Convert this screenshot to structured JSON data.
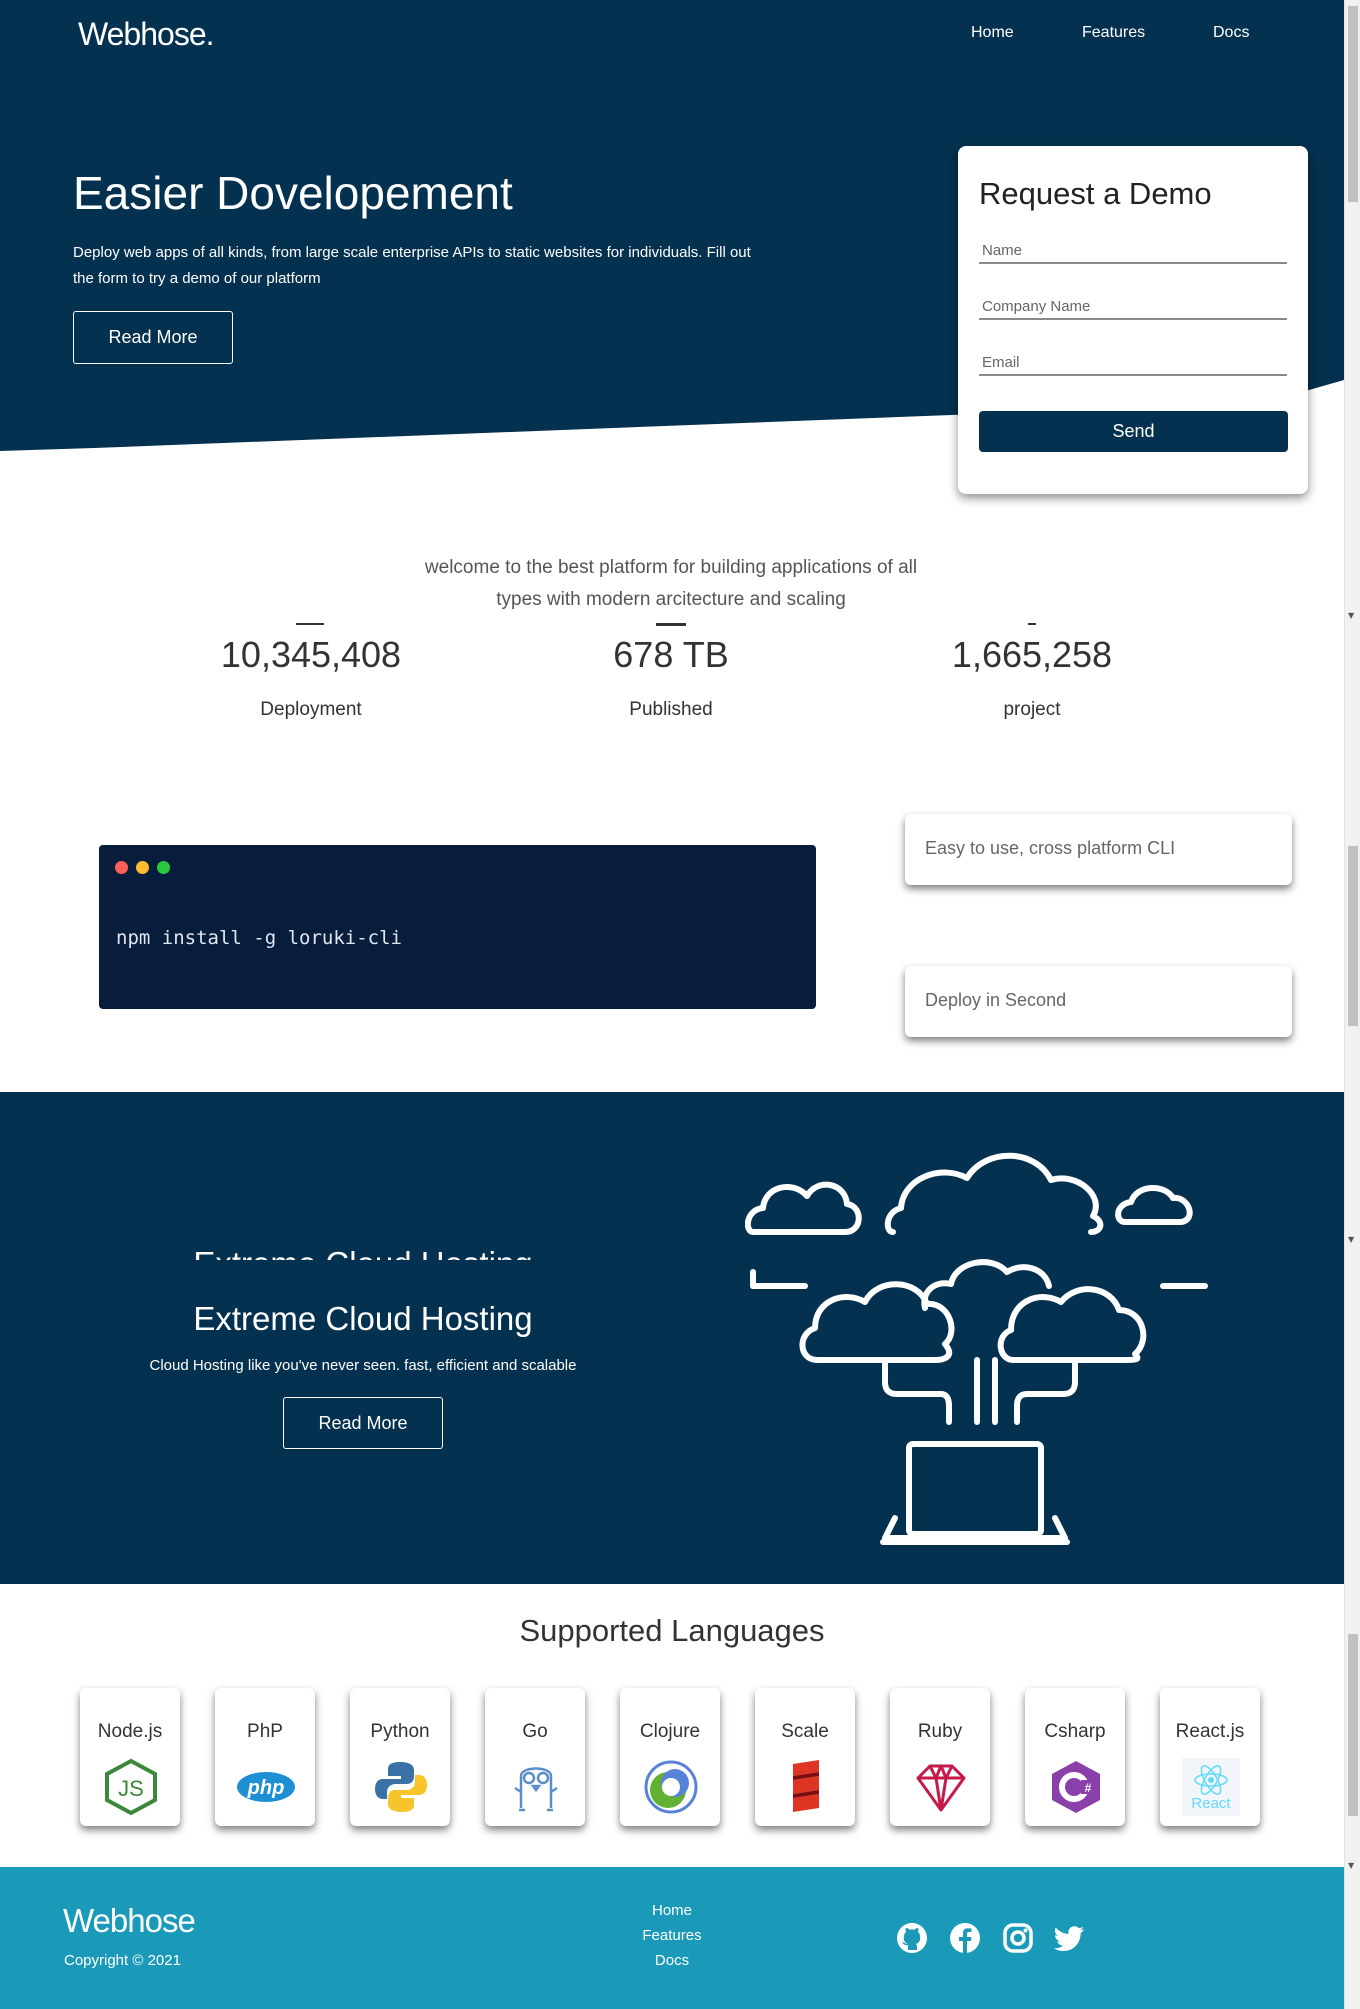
{
  "header": {
    "logo": "Webhose.",
    "nav": [
      "Home",
      "Features",
      "Docs"
    ]
  },
  "hero": {
    "title": "Easier Dovelopement",
    "description": "Deploy web apps of all kinds, from large scale enterprise APIs to static websites for individuals. Fill out the form to try a demo of our platform",
    "read_more": "Read More"
  },
  "demo_form": {
    "title": "Request a Demo",
    "name_placeholder": "Name",
    "company_placeholder": "Company Name",
    "email_placeholder": "Email",
    "send_label": "Send"
  },
  "welcome": {
    "text": "welcome to the best platform for building applications of all types with modern arcitecture and scaling"
  },
  "stats": [
    {
      "value": "10,345,408",
      "label": "Deployment"
    },
    {
      "value": "678 TB",
      "label": "Published"
    },
    {
      "value": "1,665,258",
      "label": "project"
    }
  ],
  "terminal": {
    "command": "npm install -g loruki-cli",
    "dot_colors": [
      "#ff5f57",
      "#febc2e",
      "#28c840"
    ]
  },
  "features": [
    {
      "label": "Easy to use, cross platform CLI"
    },
    {
      "label": "Deploy in Second"
    }
  ],
  "cloud_section": {
    "title": "Extreme Cloud Hosting",
    "subtitle": "Cloud Hosting like you've never seen. fast, efficient and scalable",
    "read_more": "Read More"
  },
  "languages": {
    "title": "Supported Languages",
    "items": [
      {
        "name": "Node.js",
        "icon": "nodejs-icon"
      },
      {
        "name": "PhP",
        "icon": "php-icon"
      },
      {
        "name": "Python",
        "icon": "python-icon"
      },
      {
        "name": "Go",
        "icon": "go-icon"
      },
      {
        "name": "Clojure",
        "icon": "clojure-icon"
      },
      {
        "name": "Scale",
        "icon": "scala-icon"
      },
      {
        "name": "Ruby",
        "icon": "ruby-icon"
      },
      {
        "name": "Csharp",
        "icon": "csharp-icon"
      },
      {
        "name": "React.js",
        "icon": "react-icon"
      }
    ],
    "icon_text": {
      "php": "php",
      "react": "React"
    }
  },
  "footer": {
    "logo": "Webhose",
    "copyright": "Copyright © 2021",
    "links": [
      "Home",
      "Features",
      "Docs"
    ],
    "social": [
      "github-icon",
      "facebook-icon",
      "instagram-icon",
      "twitter-icon"
    ]
  },
  "colors": {
    "primary": "#04314f",
    "footer": "#1a9ab8",
    "terminal": "#071d3b"
  }
}
